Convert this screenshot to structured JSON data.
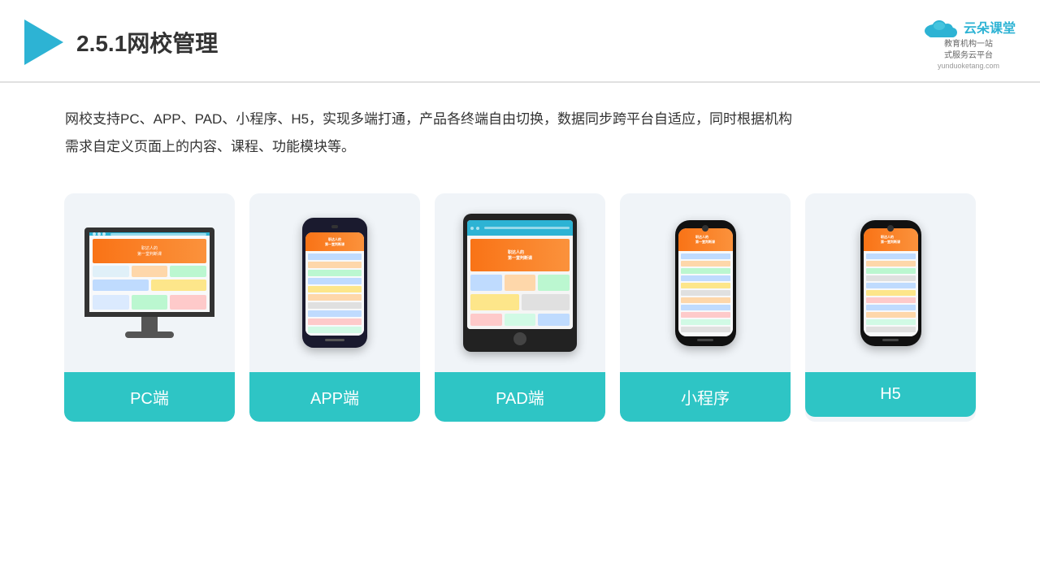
{
  "header": {
    "title": "2.5.1网校管理",
    "brand": {
      "name": "云朵课堂",
      "url": "yunduoketang.com",
      "slogan": "教育机构一站\n式服务云平台"
    }
  },
  "description": "网校支持PC、APP、PAD、小程序、H5，实现多端打通，产品各终端自由切换，数据同步跨平台自适应，同时根据机构\n需求自定义页面上的内容、课程、功能模块等。",
  "cards": [
    {
      "id": "pc",
      "label": "PC端"
    },
    {
      "id": "app",
      "label": "APP端"
    },
    {
      "id": "pad",
      "label": "PAD端"
    },
    {
      "id": "miniprogram",
      "label": "小程序"
    },
    {
      "id": "h5",
      "label": "H5"
    }
  ],
  "colors": {
    "teal": "#2ec5c5",
    "header_border": "#e0e0e0",
    "bg_card": "#f0f4f8"
  }
}
